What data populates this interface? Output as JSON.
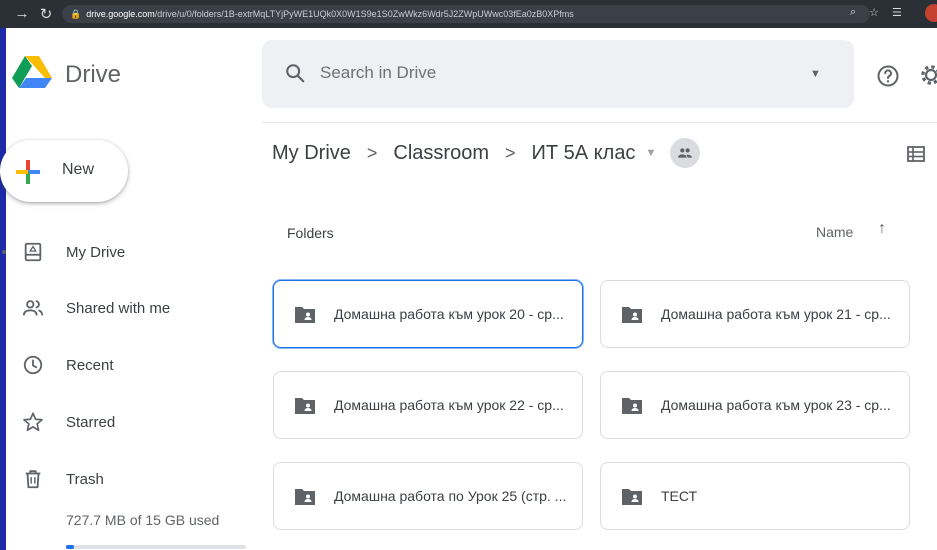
{
  "browser": {
    "url_host": "drive.google.com",
    "url_path": "/drive/u/0/folders/1B-extrMqLTYjPyWE1UQk0X0W1S9e1S0ZwWkz6Wdr5J2ZWpUWwc03fEa0zB0XPfms"
  },
  "app": {
    "title": "Drive",
    "search": {
      "placeholder": "Search in Drive"
    }
  },
  "sidebar": {
    "new_label": "New",
    "items": [
      {
        "label": "My Drive",
        "icon": "my-drive-icon"
      },
      {
        "label": "Shared with me",
        "icon": "shared-with-me-icon"
      },
      {
        "label": "Recent",
        "icon": "clock-icon"
      },
      {
        "label": "Starred",
        "icon": "star-icon"
      },
      {
        "label": "Trash",
        "icon": "trash-icon"
      }
    ],
    "storage_text": "727.7 MB of 15 GB used",
    "storage_used_fraction": 0.047
  },
  "breadcrumb": {
    "items": [
      "My Drive",
      "Classroom",
      "ИТ 5А клас"
    ],
    "separator": ">"
  },
  "main": {
    "section_title": "Folders",
    "sort_label": "Name",
    "sort_direction": "ascending",
    "folders": [
      {
        "name": "Домашна работа към урок 20 - ср..."
      },
      {
        "name": "Домашна работа към урок 21 - ср..."
      },
      {
        "name": "Домашна работа към урок 22 - ср..."
      },
      {
        "name": "Домашна работа към урок 23 - ср..."
      },
      {
        "name": "Домашна работа по Урок 25 (стр. ..."
      },
      {
        "name": "ТЕСТ"
      }
    ]
  },
  "colors": {
    "frame": "#1d2aa8",
    "accent": "#1a73e8",
    "folder_icon": "#5f6368"
  }
}
